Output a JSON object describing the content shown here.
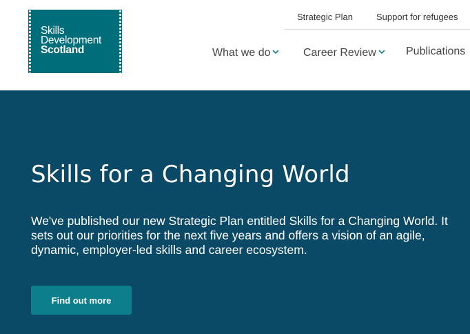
{
  "logo": {
    "line1": "Skills",
    "line2": "Development",
    "line3": "Scotland"
  },
  "util_nav": {
    "strategic_plan": "Strategic Plan",
    "support_refugees": "Support for refugees"
  },
  "main_nav": {
    "items": [
      {
        "label": "What we do",
        "has_dropdown": true
      },
      {
        "label": "Career Review",
        "has_dropdown": true
      },
      {
        "label": "Publications",
        "has_dropdown": false
      }
    ]
  },
  "hero": {
    "title": "Skills for a Changing World",
    "body": "We've published our new Strategic Plan entitled Skills for a Changing World. It sets out our priorities for the next five years and offers a vision of an agile, dynamic, employer-led skills and career ecosystem.",
    "cta_label": "Find out more"
  },
  "colors": {
    "hero_bg": "#0b4a67",
    "logo_bg": "#006e7a",
    "cta_bg": "#0d7f8c",
    "accent_chevron": "#0d7f8c"
  }
}
